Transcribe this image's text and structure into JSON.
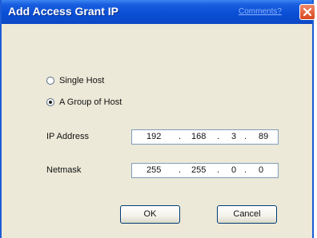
{
  "dialog": {
    "title": "Add Access Grant IP",
    "comments_link": "Comments?"
  },
  "options": {
    "single_host": "Single Host",
    "group_of_host": "A Group of Host",
    "selected": "group_of_host"
  },
  "fields": {
    "ip_label": "IP Address",
    "ip_octets": [
      "192",
      "168",
      "3",
      "89"
    ],
    "netmask_label": "Netmask",
    "netmask_octets": [
      "255",
      "255",
      "0",
      "0"
    ],
    "dot": "."
  },
  "buttons": {
    "ok": "OK",
    "cancel": "Cancel"
  }
}
